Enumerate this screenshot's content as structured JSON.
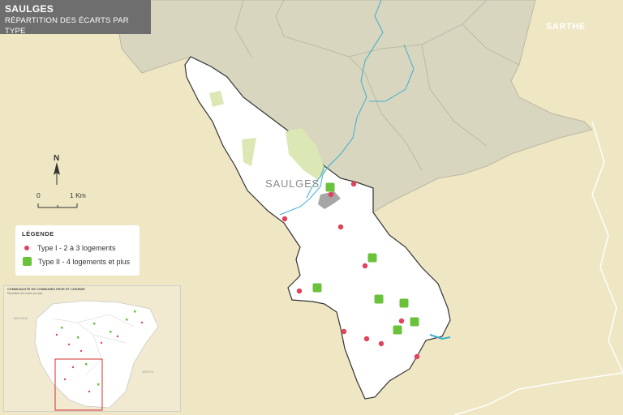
{
  "title": {
    "commune": "SAULGES",
    "subtitle": "RÉPARTITION DES ÉCARTS PAR TYPE"
  },
  "map_labels": {
    "department": "SARTHE",
    "commune_label": "SAULGES"
  },
  "scale": {
    "start": "0",
    "end": "1 Km"
  },
  "north": "N",
  "legend": {
    "title": "LÉGENDE",
    "items": [
      {
        "label": "Type I - 2 à 3 logements",
        "symbol": "red-dot"
      },
      {
        "label": "Type II - 4 logements et plus",
        "symbol": "green-square"
      }
    ]
  },
  "inset": {
    "title": "COMMUNAUTÉ DE COMMUNES ERVE ET CHARNIE",
    "subtitle": "Répartition des écarts par type",
    "mayenne": "MAYENNE",
    "sarthe": "SARTHE"
  },
  "colors": {
    "background": "#efe6c3",
    "neighbor_communes": "#d9d6c0",
    "commune_fill": "#ffffff",
    "forest": "#dbe7b5",
    "river": "#3ab0d0",
    "type1": "#e0435c",
    "type2": "#6ac23a",
    "title_bar": "#6e6e6e"
  }
}
